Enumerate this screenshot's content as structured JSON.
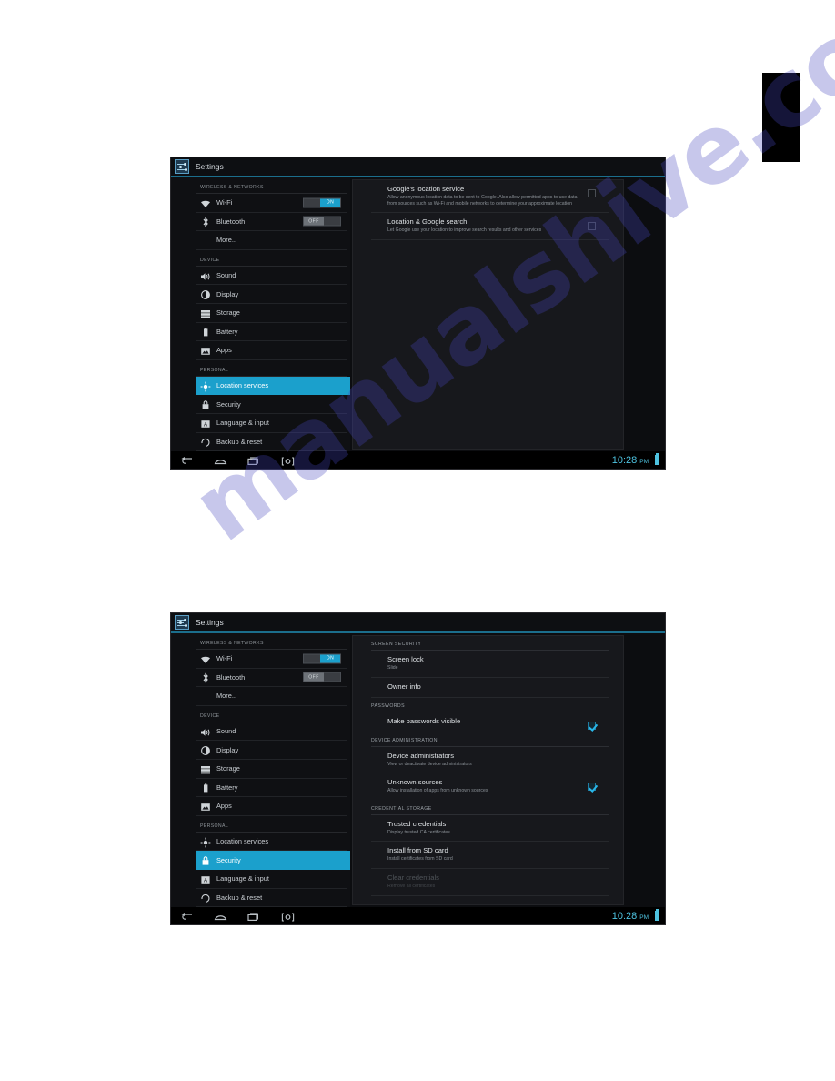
{
  "page": {
    "watermark_text": "manualshive.com",
    "edge_tab_color": "#000000",
    "accent_color": "#1ba0cc",
    "clock_color": "#4ec3e0"
  },
  "titlebar": {
    "app_title": "Settings",
    "icon": "settings-sliders-icon"
  },
  "sidebar": {
    "sections": [
      {
        "header": "WIRELESS & NETWORKS",
        "items": [
          {
            "label": "Wi-Fi",
            "icon": "wifi-icon",
            "toggle": "ON",
            "toggle_state": "on"
          },
          {
            "label": "Bluetooth",
            "icon": "bluetooth-icon",
            "toggle": "OFF",
            "toggle_state": "off"
          },
          {
            "label": "More..",
            "icon": "none",
            "indent": true
          }
        ]
      },
      {
        "header": "DEVICE",
        "items": [
          {
            "label": "Sound",
            "icon": "sound-icon"
          },
          {
            "label": "Display",
            "icon": "display-icon"
          },
          {
            "label": "Storage",
            "icon": "storage-icon"
          },
          {
            "label": "Battery",
            "icon": "battery-icon"
          },
          {
            "label": "Apps",
            "icon": "apps-icon"
          }
        ]
      },
      {
        "header": "PERSONAL",
        "items": [
          {
            "label": "Location services",
            "icon": "location-icon"
          },
          {
            "label": "Security",
            "icon": "lock-icon"
          },
          {
            "label": "Language & input",
            "icon": "language-icon"
          },
          {
            "label": "Backup & reset",
            "icon": "backup-icon"
          }
        ]
      }
    ]
  },
  "screenshot_1": {
    "selected_sidebar_item": "Location services",
    "content": {
      "items": [
        {
          "title": "Google's location service",
          "subtitle": "Allow anonymous location data to be sent to Google. Also allow permitted apps to use data from sources such as Wi-Fi and mobile networks to determine your approximate location",
          "checked": false
        },
        {
          "title": "Location & Google search",
          "subtitle": "Let Google use your location to improve search results and other services",
          "checked": false
        }
      ]
    }
  },
  "screenshot_2": {
    "selected_sidebar_item": "Security",
    "content": {
      "groups": [
        {
          "header": "SCREEN SECURITY",
          "items": [
            {
              "title": "Screen lock",
              "subtitle": "Slide",
              "checkbox": false
            },
            {
              "title": "Owner info",
              "subtitle": "",
              "checkbox": false
            }
          ]
        },
        {
          "header": "PASSWORDS",
          "items": [
            {
              "title": "Make passwords visible",
              "subtitle": "",
              "checkbox": true,
              "checked": true
            }
          ]
        },
        {
          "header": "DEVICE ADMINISTRATION",
          "items": [
            {
              "title": "Device administrators",
              "subtitle": "View or deactivate device administrators",
              "checkbox": false
            },
            {
              "title": "Unknown sources",
              "subtitle": "Allow installation of apps from unknown sources",
              "checkbox": true,
              "checked": true
            }
          ]
        },
        {
          "header": "CREDENTIAL STORAGE",
          "items": [
            {
              "title": "Trusted credentials",
              "subtitle": "Display trusted CA certificates",
              "checkbox": false
            },
            {
              "title": "Install from SD card",
              "subtitle": "Install certificates from SD card",
              "checkbox": false
            },
            {
              "title": "Clear credentials",
              "subtitle": "Remove all certificates",
              "checkbox": false,
              "disabled": true
            }
          ]
        }
      ]
    }
  },
  "navbar": {
    "icons": [
      "back-icon",
      "home-icon",
      "recents-icon",
      "screenshot-icon"
    ],
    "clock": "10:28",
    "ampm": "PM",
    "battery": "battery-full-icon"
  }
}
